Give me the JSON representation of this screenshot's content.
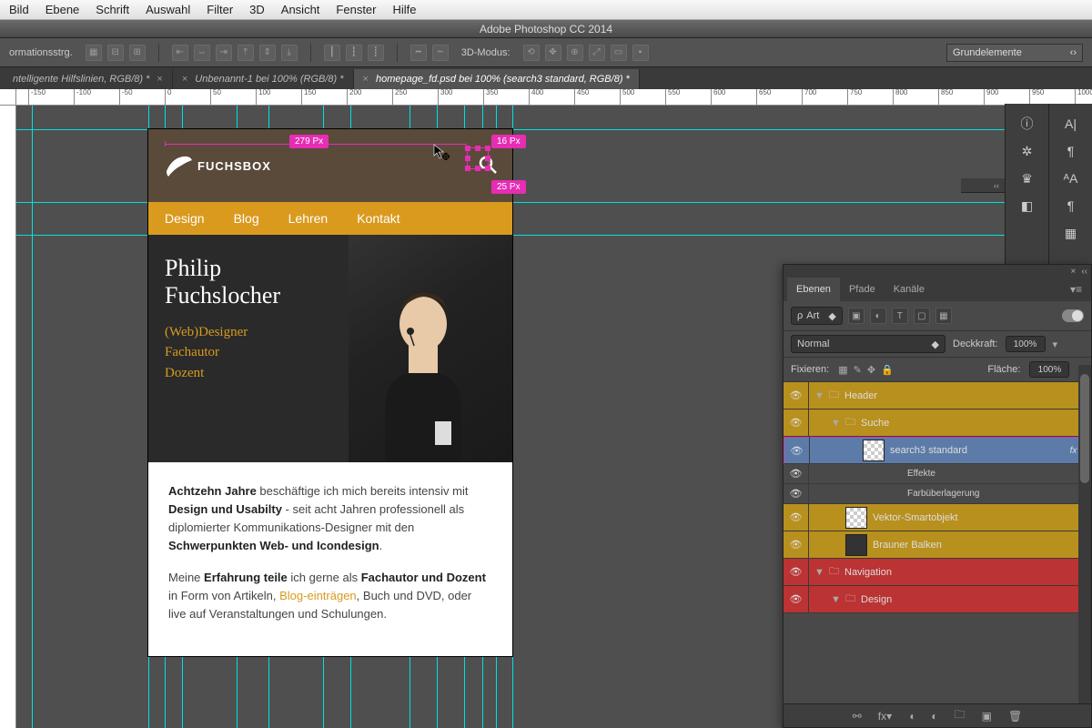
{
  "menu": [
    "Bild",
    "Ebene",
    "Schrift",
    "Auswahl",
    "Filter",
    "3D",
    "Ansicht",
    "Fenster",
    "Hilfe"
  ],
  "app_title": "Adobe Photoshop CC 2014",
  "options": {
    "label": "ormationsstrg.",
    "mode": "3D-Modus:",
    "basis": "Grundelemente"
  },
  "tabs": [
    {
      "label": "ntelligente Hilfslinien, RGB/8) *",
      "active": false
    },
    {
      "label": "Unbenannt-1 bei 100% (RGB/8) *",
      "active": false
    },
    {
      "label": "homepage_fd.psd bei 100% (search3 standard, RGB/8) *",
      "active": true
    }
  ],
  "ruler_ticks": [
    -150,
    -100,
    -50,
    0,
    50,
    100,
    150,
    200,
    250,
    300,
    350,
    400,
    450,
    500,
    550,
    600,
    650,
    700,
    750,
    800,
    850,
    900,
    950,
    700
  ],
  "measurements": {
    "w": "279 Px",
    "iw": "16 Px",
    "ih": "25 Px"
  },
  "mock": {
    "logo": "FUCHSBOX",
    "nav": [
      "Design",
      "Blog",
      "Lehren",
      "Kontakt"
    ],
    "name": "Philip Fuchslocher",
    "sub": "(Web)Designer\nFachautor\nDozent",
    "p1a": "Achtzehn Jahre",
    "p1b": " beschäftige ich mich bereits intensiv mit ",
    "p1c": "Design und Usabilty",
    "p1d": " - seit acht Jahren professionell als diplomierter Kommunikations-Designer mit den ",
    "p1e": "Schwerpunkten Web- und Icondesign",
    "p1f": ".",
    "p2a": "Meine ",
    "p2b": "Erfahrung teile",
    "p2c": " ich gerne als ",
    "p2d": "Fachautor und Dozent",
    "p2e": " in Form von Artikeln, ",
    "p2f": "Blog-einträgen",
    "p2g": ", Buch und DVD, oder live auf Veranstaltungen und Schulungen."
  },
  "panels": {
    "tabs": [
      "Ebenen",
      "Pfade",
      "Kanäle"
    ],
    "filter": "Art",
    "blend": "Normal",
    "opacity_label": "Deckkraft:",
    "opacity": "100%",
    "fill_label": "Fläche:",
    "fill": "100%",
    "lock_label": "Fixieren:",
    "layers": [
      {
        "type": "group",
        "name": "Header",
        "hl": true,
        "indent": 0,
        "open": true
      },
      {
        "type": "group",
        "name": "Suche",
        "hl": true,
        "indent": 1,
        "open": true
      },
      {
        "type": "smart",
        "name": "search3 standard",
        "sel": true,
        "indent": 2,
        "fx": true
      },
      {
        "type": "fx",
        "name": "Effekte",
        "indent": 3
      },
      {
        "type": "fx",
        "name": "Farbüberlagerung",
        "indent": 3
      },
      {
        "type": "smart",
        "name": "Vektor-Smartobjekt",
        "hl": true,
        "indent": 1
      },
      {
        "type": "layer",
        "name": "Brauner Balken",
        "hl": true,
        "indent": 1
      },
      {
        "type": "group",
        "name": "Navigation",
        "hl2": true,
        "indent": 0,
        "open": true
      },
      {
        "type": "group",
        "name": "Design",
        "hl2": true,
        "indent": 1,
        "open": true
      }
    ]
  }
}
